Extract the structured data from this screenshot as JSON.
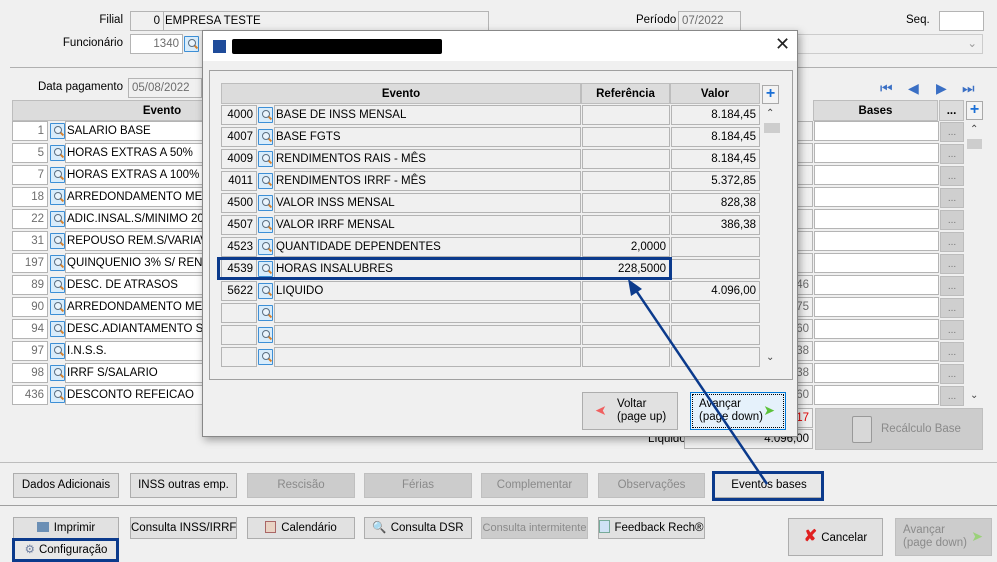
{
  "header": {
    "filial_label": "Filial",
    "filial_code": "0",
    "filial_name": "EMPRESA TESTE",
    "funcionario_label": "Funcionário",
    "funcionario_code": "1340",
    "periodo_label": "Período",
    "periodo_value": "07/2022",
    "seq_label": "Seq.",
    "seq_value": "",
    "data_pagamento_label": "Data pagamento",
    "data_pagamento_value": "05/08/2022"
  },
  "main_grid": {
    "columns": {
      "evento": "Evento",
      "bases": "Bases",
      "more": "..."
    },
    "rows": [
      {
        "code": "1",
        "name": "SALARIO BASE",
        "value_fragment": ""
      },
      {
        "code": "5",
        "name": "HORAS EXTRAS A 50%",
        "value_fragment": ""
      },
      {
        "code": "7",
        "name": "HORAS EXTRAS A 100%",
        "value_fragment": ""
      },
      {
        "code": "18",
        "name": "ARREDONDAMENTO MES AT",
        "value_fragment": ""
      },
      {
        "code": "22",
        "name": "ADIC.INSAL.S/MINIMO 20%",
        "value_fragment": ""
      },
      {
        "code": "31",
        "name": "REPOUSO REM.S/VARIAVEIS",
        "value_fragment": ""
      },
      {
        "code": "197",
        "name": "QUINQUENIO 3% S/ RENDIM",
        "value_fragment": ""
      },
      {
        "code": "89",
        "name": "DESC. DE ATRASOS",
        "value_fragment": "46"
      },
      {
        "code": "90",
        "name": "ARREDONDAMENTO MES AN",
        "value_fragment": "75"
      },
      {
        "code": "94",
        "name": "DESC.ADIANTAMENTO SALA",
        "value_fragment": "60"
      },
      {
        "code": "97",
        "name": "I.N.S.S.",
        "value_fragment": "38"
      },
      {
        "code": "98",
        "name": "IRRF S/SALARIO",
        "value_fragment": "38"
      },
      {
        "code": "436",
        "name": "DESCONTO REFEICAO",
        "value_fragment": "60"
      }
    ],
    "more_button": "...",
    "total_fragment": "17",
    "liquido_label": "Líquido",
    "liquido_value": "4.096,00",
    "recalculo_label": "Recálculo Base"
  },
  "action_buttons": [
    "Dados Adicionais",
    "INSS outras emp.",
    "Rescisão",
    "Férias",
    "Complementar",
    "Observações",
    "Eventos bases"
  ],
  "bottom_buttons": {
    "imprimir": "Imprimir",
    "consulta_inss": "Consulta INSS/IRRF",
    "calendario": "Calendário",
    "consulta_dsr": "Consulta DSR",
    "consulta_intermitente": "Consulta intermitente",
    "feedback": "Feedback Rech®",
    "configuracao": "Configuração",
    "cancelar": "Cancelar",
    "avancar_line1": "Avançar",
    "avancar_line2": "(page down)"
  },
  "dialog": {
    "columns": {
      "evento": "Evento",
      "referencia": "Referência",
      "valor": "Valor"
    },
    "rows": [
      {
        "code": "4000",
        "name": "BASE DE INSS MENSAL",
        "ref": "",
        "valor": "8.184,45"
      },
      {
        "code": "4007",
        "name": "BASE FGTS",
        "ref": "",
        "valor": "8.184,45"
      },
      {
        "code": "4009",
        "name": "RENDIMENTOS RAIS - MÊS",
        "ref": "",
        "valor": "8.184,45"
      },
      {
        "code": "4011",
        "name": "RENDIMENTOS IRRF - MÊS",
        "ref": "",
        "valor": "5.372,85"
      },
      {
        "code": "4500",
        "name": "VALOR INSS MENSAL",
        "ref": "",
        "valor": "828,38"
      },
      {
        "code": "4507",
        "name": "VALOR IRRF MENSAL",
        "ref": "",
        "valor": "386,38"
      },
      {
        "code": "4523",
        "name": "QUANTIDADE DEPENDENTES",
        "ref": "2,0000",
        "valor": ""
      },
      {
        "code": "4539",
        "name": "HORAS INSALUBRES",
        "ref": "228,5000",
        "valor": ""
      },
      {
        "code": "5622",
        "name": "LIQUIDO",
        "ref": "",
        "valor": "4.096,00"
      },
      {
        "code": "",
        "name": "",
        "ref": "",
        "valor": ""
      },
      {
        "code": "",
        "name": "",
        "ref": "",
        "valor": ""
      },
      {
        "code": "",
        "name": "",
        "ref": "",
        "valor": ""
      }
    ],
    "highlighted_code": "4539",
    "voltar_line1": "Voltar",
    "voltar_line2": "(page up)",
    "avancar_line1": "Avançar",
    "avancar_line2": "(page down)"
  },
  "colors": {
    "highlight": "#0b3a8c",
    "negative": "#e00000",
    "accent_plus": "#1a6fd6"
  }
}
